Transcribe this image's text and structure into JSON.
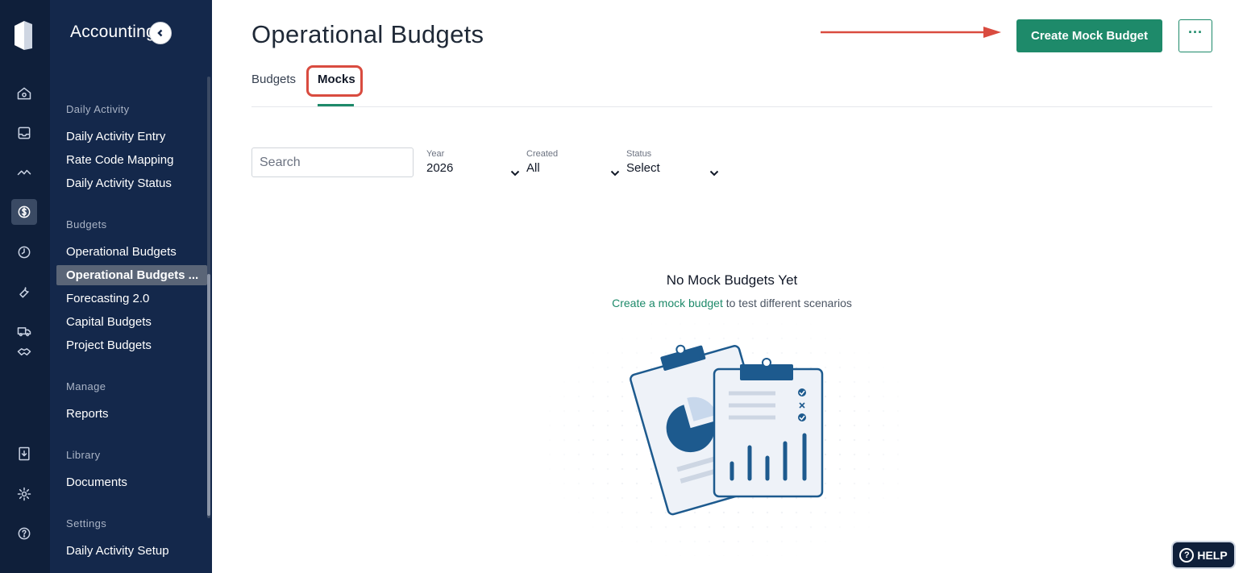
{
  "sidebar": {
    "app_title": "Accounting",
    "rail_icons": [
      "home-icon",
      "inbox-icon",
      "activity-icon",
      "dollar-icon",
      "clock-icon",
      "wrench-icon",
      "truck-icon",
      "handshake-icon",
      "book-icon",
      "gear-icon",
      "help-circle-icon"
    ],
    "sections": [
      {
        "heading": "Daily Activity",
        "items": [
          "Daily Activity Entry",
          "Rate Code Mapping",
          "Daily Activity Status"
        ]
      },
      {
        "heading": "Budgets",
        "items": [
          "Operational Budgets",
          "Operational Budgets ...",
          "Forecasting 2.0",
          "Capital Budgets",
          "Project Budgets"
        ]
      },
      {
        "heading": "Manage",
        "items": [
          "Reports"
        ]
      },
      {
        "heading": "Library",
        "items": [
          "Documents"
        ]
      },
      {
        "heading": "Settings",
        "items": [
          "Daily Activity Setup"
        ]
      }
    ],
    "active_item": "Operational Budgets ..."
  },
  "header": {
    "title": "Operational Budgets",
    "create_button": "Create Mock Budget",
    "more_button": "···"
  },
  "tabs": [
    {
      "label": "Budgets",
      "active": false
    },
    {
      "label": "Mocks",
      "active": true
    }
  ],
  "filters": {
    "search_placeholder": "Search",
    "year": {
      "label": "Year",
      "value": "2026"
    },
    "created": {
      "label": "Created",
      "value": "All"
    },
    "status": {
      "label": "Status",
      "value": "Select"
    }
  },
  "empty_state": {
    "title": "No Mock Budgets Yet",
    "link_text": "Create a mock budget",
    "suffix_text": " to test different scenarios"
  },
  "help": {
    "label": "HELP"
  },
  "colors": {
    "accent": "#1e8a6a",
    "sidebar": "#14284b",
    "rail": "#0f1f3a",
    "highlight": "#d94b3f"
  }
}
